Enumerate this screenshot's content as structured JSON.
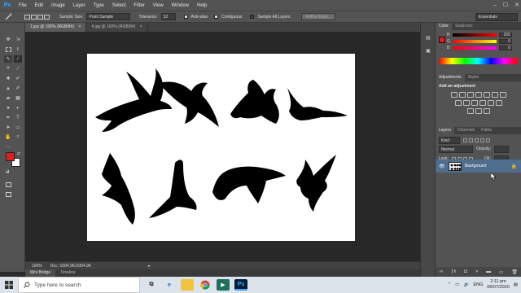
{
  "app": {
    "logo": "Ps"
  },
  "menu": [
    "File",
    "Edit",
    "Image",
    "Layer",
    "Type",
    "Select",
    "Filter",
    "View",
    "Window",
    "Help"
  ],
  "window_controls": [
    "–",
    "☐",
    "✕"
  ],
  "options": {
    "sample_size_label": "Sample Size:",
    "sample_size_value": "Point Sample",
    "tolerance_label": "Tolerance:",
    "tolerance_value": "32",
    "anti_alias": "Anti-alias",
    "contiguous": "Contiguous",
    "sample_all_layers": "Sample All Layers",
    "refine_edge": "Refine Edge...",
    "workspace": "Essentials"
  },
  "doc_tabs": [
    {
      "label": "1.jpg @ 100% (RGB/8#)",
      "close": "×"
    },
    {
      "label": "4.jpg @ 100% (RGB/8#)",
      "close": "×"
    }
  ],
  "colors": {
    "foreground": "#e41b1b",
    "background": "#ffffff",
    "accent": "#31a8ff",
    "selected_layer": "#4f6d8c"
  },
  "status": {
    "zoom": "100%",
    "doc": "Doc: 1004.9K/1004.9K"
  },
  "bottom_tabs": [
    "Mini Bridge",
    "Timeline"
  ],
  "color_panel": {
    "tabs": [
      "Color",
      "Swatches"
    ],
    "channels": [
      {
        "label": "R",
        "value": "255"
      },
      {
        "label": "G",
        "value": "0"
      },
      {
        "label": "B",
        "value": "0"
      }
    ]
  },
  "adjustments_panel": {
    "tabs": [
      "Adjustments",
      "Styles"
    ],
    "heading": "Add an adjustment"
  },
  "layers_panel": {
    "tabs": [
      "Layers",
      "Channels",
      "Paths"
    ],
    "kind": "Kind",
    "blend_mode": "Normal",
    "opacity_label": "Opacity:",
    "lock_label": "Lock:",
    "fill_label": "Fill:",
    "layer_name": "Background"
  },
  "taskbar": {
    "search_placeholder": "Type here to search",
    "language": "ENG",
    "time": "2:11 pm",
    "date": "06/07/2020"
  }
}
